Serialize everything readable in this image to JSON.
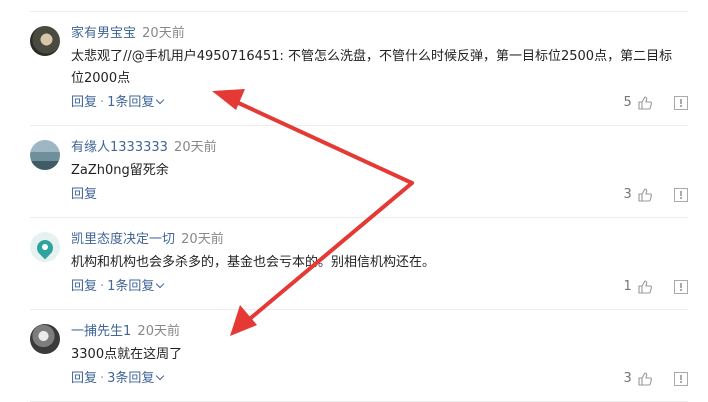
{
  "comments": [
    {
      "user": "家有男宝宝",
      "time": "20天前",
      "text": "太悲观了//@手机用户4950716451: 不管怎么洗盘，不管什么时候反弹，第一目标位2500点，第二目标位2000点",
      "reply_label": "回复",
      "replies_label": "1条回复",
      "likes": "5"
    },
    {
      "user": "有缘人1333333",
      "time": "20天前",
      "text": "ZaZh0ng留死余",
      "reply_label": "回复",
      "likes": "3"
    },
    {
      "user": "凯里态度决定一切",
      "time": "20天前",
      "text": "机构和机构也会多杀多的，基金也会亏本的。别相信机构还在。",
      "reply_label": "回复",
      "replies_label": "1条回复",
      "likes": "1"
    },
    {
      "user": "一捕先生1",
      "time": "20天前",
      "text": "3300点就在这周了",
      "reply_label": "回复",
      "replies_label": "3条回复",
      "likes": "3"
    }
  ],
  "annotation_color": "#e53935",
  "link_color": "#406599"
}
